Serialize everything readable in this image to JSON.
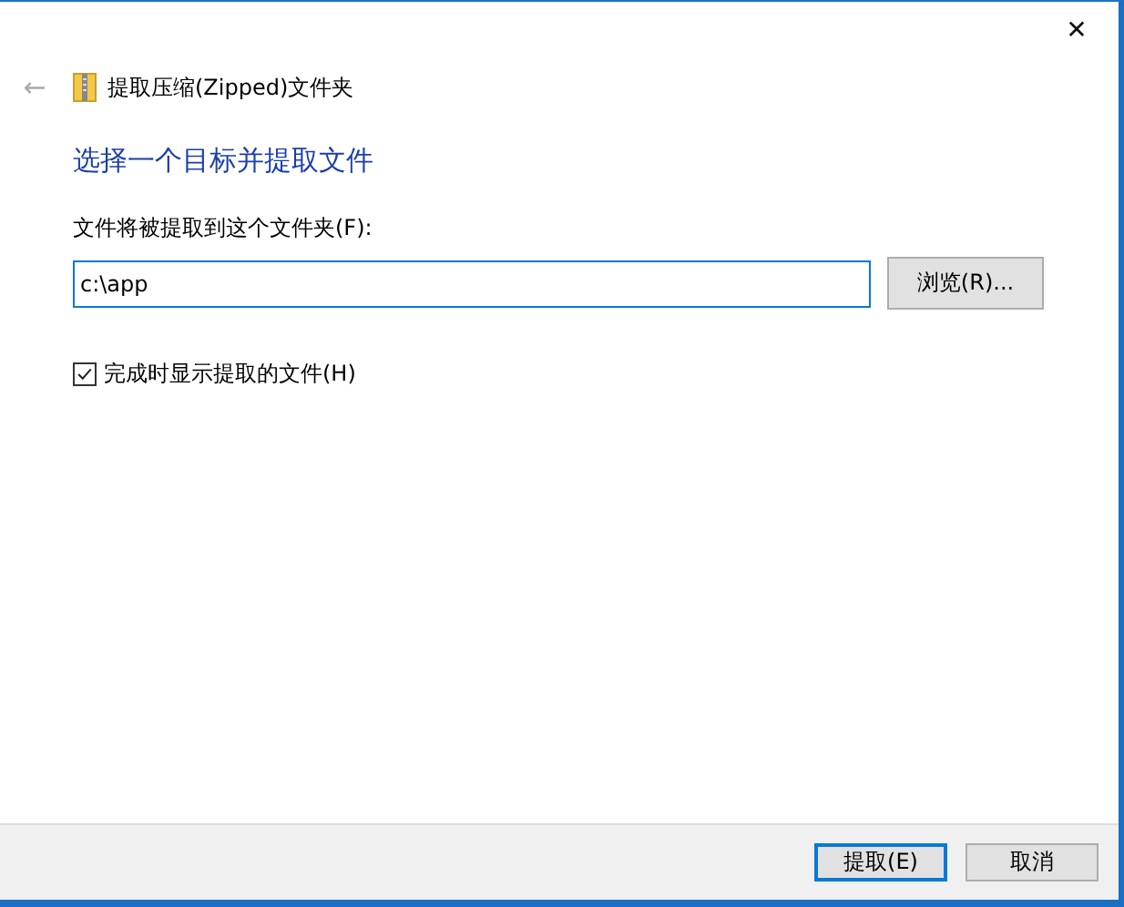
{
  "window": {
    "close": "✕",
    "back": "←",
    "title": "提取压缩(Zipped)文件夹"
  },
  "heading": "选择一个目标并提取文件",
  "destination": {
    "label": "文件将被提取到这个文件夹(F):",
    "value": "c:\\app",
    "browse": "浏览(R)..."
  },
  "show_files": {
    "label": "完成时显示提取的文件(H)",
    "checked": true
  },
  "buttons": [
    {
      "label": "提取(E)",
      "kind": "default"
    },
    {
      "label": "取消",
      "kind": "normal"
    }
  ]
}
